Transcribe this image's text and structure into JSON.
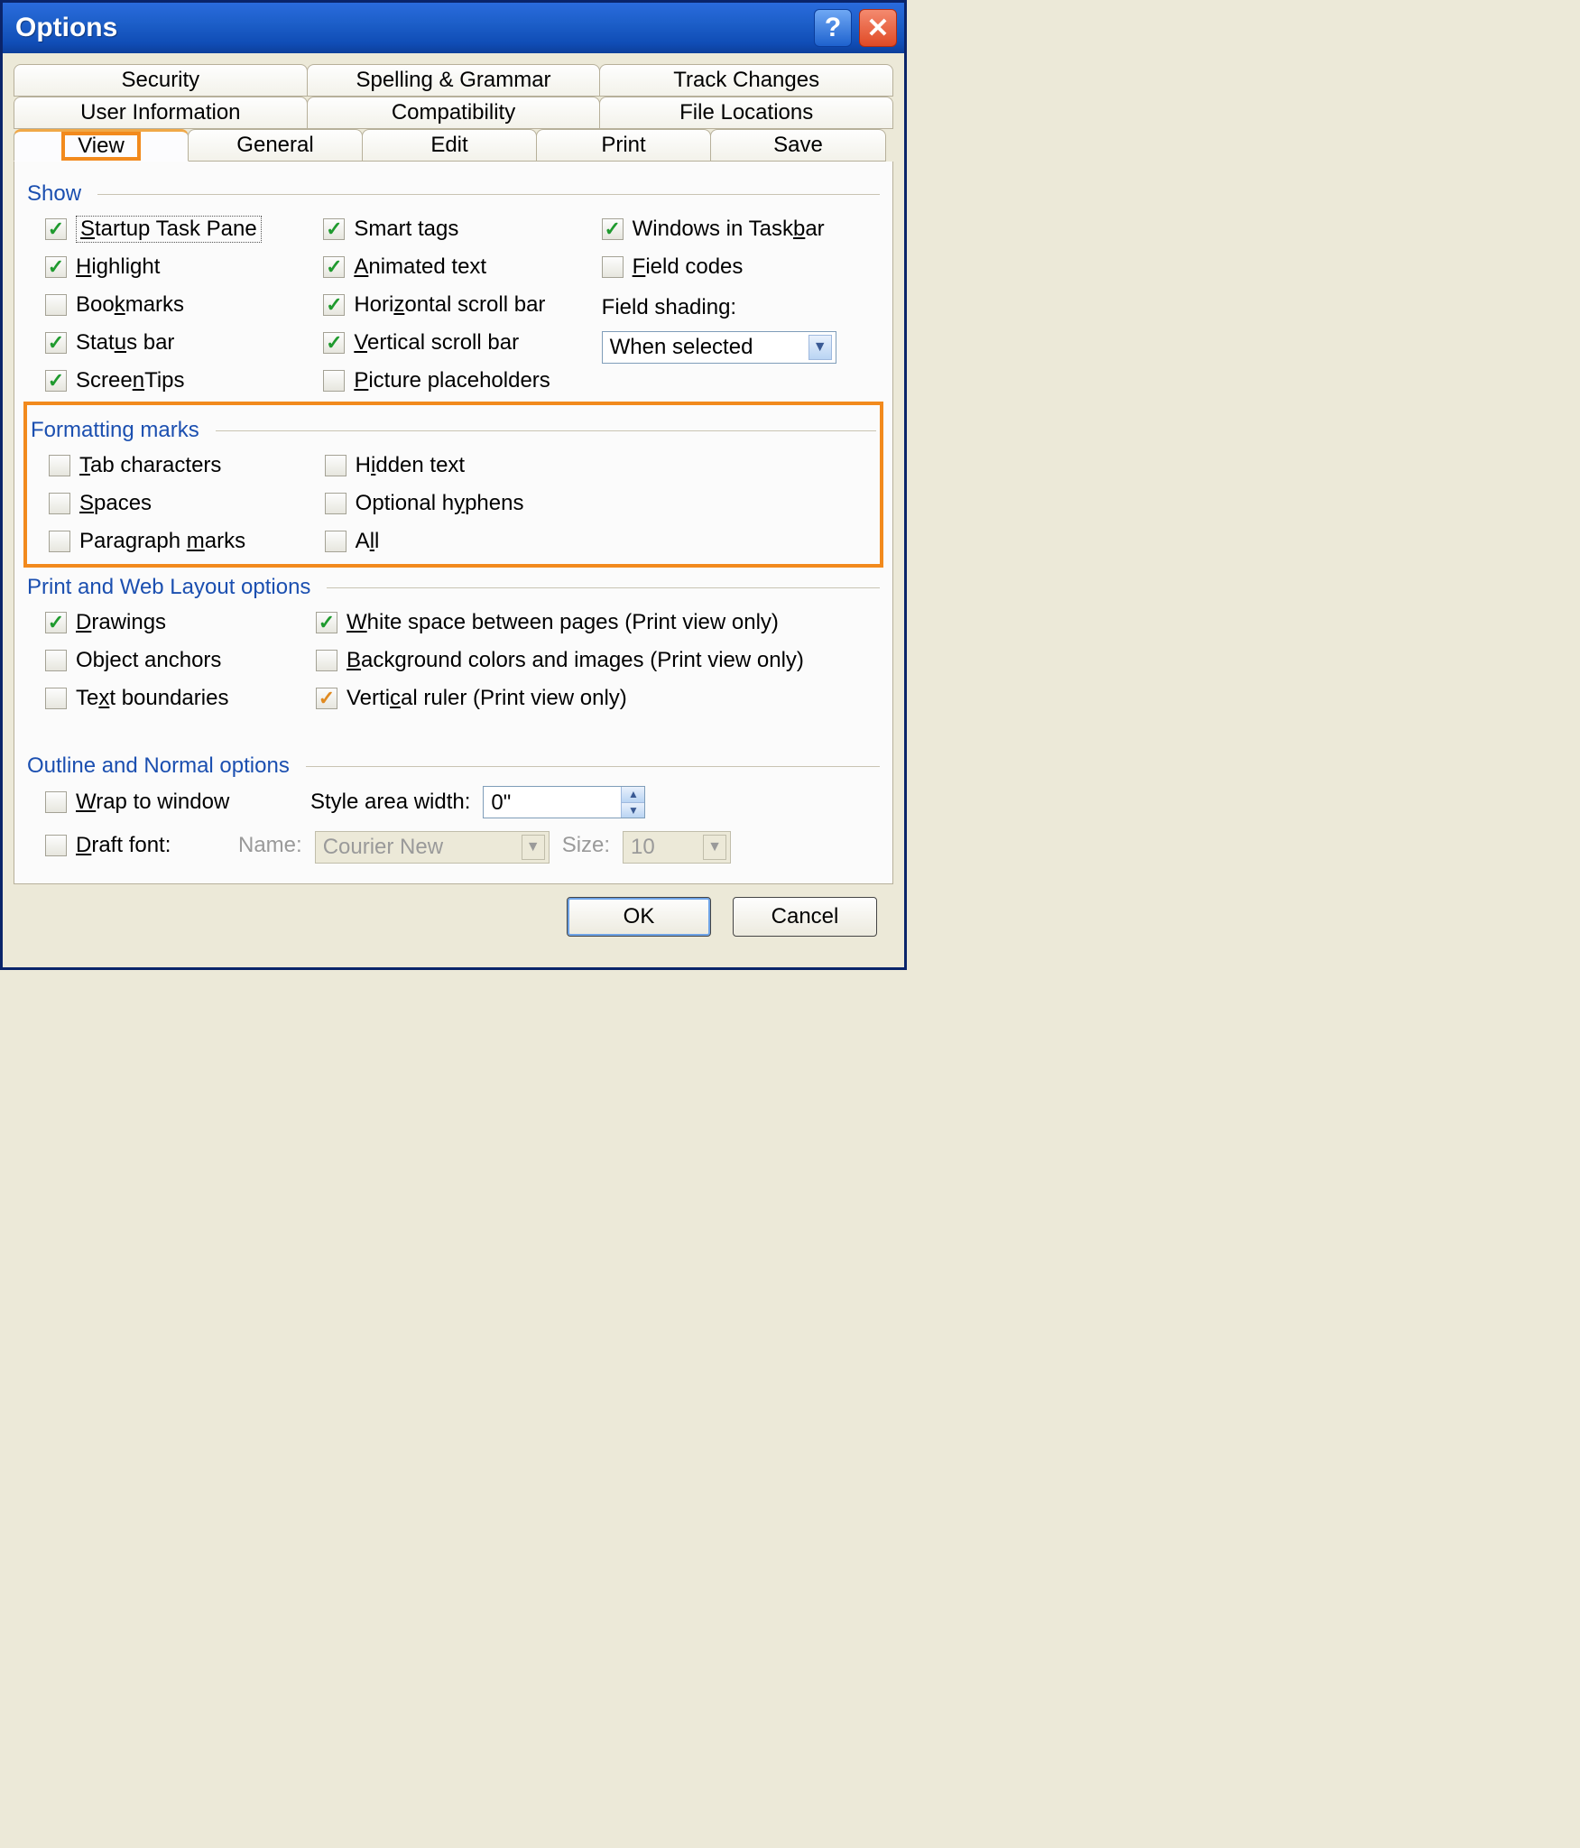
{
  "window": {
    "title": "Options"
  },
  "tabs": {
    "row1": [
      "Security",
      "Spelling & Grammar",
      "Track Changes"
    ],
    "row2": [
      "User Information",
      "Compatibility",
      "File Locations"
    ],
    "row3": [
      "View",
      "General",
      "Edit",
      "Print",
      "Save"
    ],
    "active": "View"
  },
  "sections": {
    "show": {
      "title": "Show",
      "col1": [
        {
          "label": "Startup Task Pane",
          "checked": true,
          "focused": true,
          "u": "S"
        },
        {
          "label": "Highlight",
          "checked": true,
          "u": "H"
        },
        {
          "label": "Bookmarks",
          "checked": false,
          "u": "k"
        },
        {
          "label": "Status bar",
          "checked": true,
          "u": "u"
        },
        {
          "label": "ScreenTips",
          "checked": true,
          "u": "n"
        }
      ],
      "col2": [
        {
          "label": "Smart tags",
          "checked": true,
          "u": "g"
        },
        {
          "label": "Animated text",
          "checked": true,
          "u": "A"
        },
        {
          "label": "Horizontal scroll bar",
          "checked": true,
          "u": "z"
        },
        {
          "label": "Vertical scroll bar",
          "checked": true,
          "u": "V"
        },
        {
          "label": "Picture placeholders",
          "checked": false,
          "u": "P"
        }
      ],
      "col3": [
        {
          "label": "Windows in Taskbar",
          "checked": true,
          "u": "b"
        },
        {
          "label": "Field codes",
          "checked": false,
          "u": "F"
        }
      ],
      "field_shading_label": "Field shading:",
      "field_shading_value": "When selected"
    },
    "formatting": {
      "title": "Formatting marks",
      "col1": [
        {
          "label": "Tab characters",
          "checked": false,
          "u": "T"
        },
        {
          "label": "Spaces",
          "checked": false,
          "u": "S"
        },
        {
          "label": "Paragraph marks",
          "checked": false,
          "u": "m"
        }
      ],
      "col2": [
        {
          "label": "Hidden text",
          "checked": false,
          "u": "i"
        },
        {
          "label": "Optional hyphens",
          "checked": false,
          "u": "y"
        },
        {
          "label": "All",
          "checked": false,
          "u": "l"
        }
      ]
    },
    "printweb": {
      "title": "Print and Web Layout options",
      "col1": [
        {
          "label": "Drawings",
          "checked": true,
          "u": "D"
        },
        {
          "label": "Object anchors",
          "checked": false,
          "u": "j"
        },
        {
          "label": "Text boundaries",
          "checked": false,
          "u": "x"
        }
      ],
      "col2": [
        {
          "label": "White space between pages (Print view only)",
          "checked": true,
          "u": "W"
        },
        {
          "label": "Background colors and images (Print view only)",
          "checked": false,
          "u": "B"
        },
        {
          "label": "Vertical ruler (Print view only)",
          "checked": true,
          "orange": true,
          "u": "c"
        }
      ]
    },
    "outline": {
      "title": "Outline and Normal options",
      "wrap": {
        "label": "Wrap to window",
        "checked": false,
        "u": "W"
      },
      "draft": {
        "label": "Draft font:",
        "checked": false,
        "u": "D"
      },
      "style_area_label": "Style area width:",
      "style_area_value": "0\"",
      "name_label": "Name:",
      "name_value": "Courier New",
      "size_label": "Size:",
      "size_value": "10"
    }
  },
  "footer": {
    "ok": "OK",
    "cancel": "Cancel"
  }
}
